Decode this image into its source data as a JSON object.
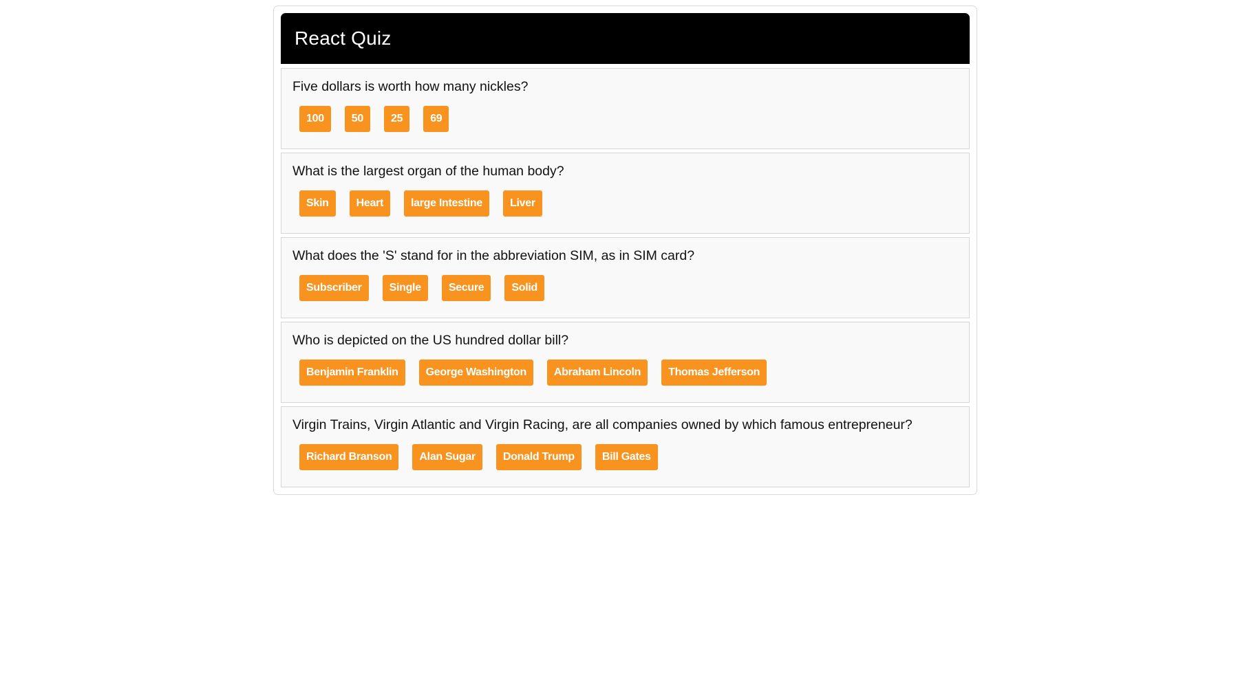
{
  "app": {
    "title": "React Quiz"
  },
  "colors": {
    "header_bg": "#000000",
    "button_bg": "#f7931e",
    "card_bg": "#f9f9f9"
  },
  "questions": [
    {
      "text": "Five dollars is worth how many nickles?",
      "answers": [
        "100",
        "50",
        "25",
        "69"
      ]
    },
    {
      "text": "What is the largest organ of the human body?",
      "answers": [
        "Skin",
        "Heart",
        "large Intestine",
        "Liver"
      ]
    },
    {
      "text": "What does the 'S' stand for in the abbreviation SIM, as in SIM card?",
      "answers": [
        "Subscriber",
        "Single",
        "Secure",
        "Solid"
      ]
    },
    {
      "text": "Who is depicted on the US hundred dollar bill?",
      "answers": [
        "Benjamin Franklin",
        "George Washington",
        "Abraham Lincoln",
        "Thomas Jefferson"
      ]
    },
    {
      "text": "Virgin Trains, Virgin Atlantic and Virgin Racing, are all companies owned by which famous entrepreneur?",
      "answers": [
        "Richard Branson",
        "Alan Sugar",
        "Donald Trump",
        "Bill Gates"
      ]
    }
  ]
}
